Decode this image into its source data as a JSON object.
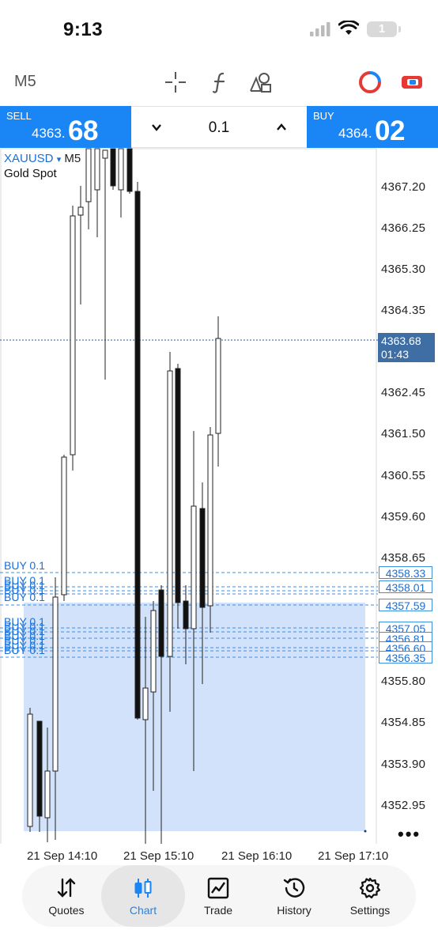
{
  "status_bar": {
    "time": "9:13",
    "battery": "1"
  },
  "toolbar": {
    "timeframe": "M5",
    "icons": [
      "crosshair-icon",
      "indicators-icon",
      "objects-icon",
      "flame-icon",
      "trade-toggle-icon"
    ]
  },
  "trade_panel": {
    "sell": {
      "label": "SELL",
      "price_prefix": "4363.",
      "price_big": "68"
    },
    "buy": {
      "label": "BUY",
      "price_prefix": "4364.",
      "price_big": "02"
    },
    "lot": "0.1"
  },
  "chart": {
    "symbol": "XAUUSD",
    "symbol_arrow": "▾",
    "timeframe": "M5",
    "description": "Gold Spot",
    "price_ticks": [
      "4367.20",
      "4366.25",
      "4365.30",
      "4364.35",
      "4362.45",
      "4361.50",
      "4360.55",
      "4359.60",
      "4358.65",
      "4355.80",
      "4354.85",
      "4353.90",
      "4352.95"
    ],
    "current_price": "4363.68",
    "countdown": "01:43",
    "order_prices": [
      "4358.33",
      "4358.01",
      "4357.59",
      "4357.05",
      "4356.81",
      "4356.60",
      "4356.35"
    ],
    "buy_label": "BUY 0.1",
    "time_labels": [
      "21 Sep 14:10",
      "21 Sep 15:10",
      "21 Sep 16:10",
      "21 Sep 17:10"
    ],
    "more": "•••",
    "colors": {
      "accent": "#1a86f5",
      "order_line": "#3d8fe0",
      "current_line": "#2f5a9e",
      "zone": "#d3e2fb"
    }
  },
  "tabs": [
    {
      "label": "Quotes",
      "icon": "quotes-icon"
    },
    {
      "label": "Chart",
      "icon": "chart-icon",
      "active": true
    },
    {
      "label": "Trade",
      "icon": "trade-icon"
    },
    {
      "label": "History",
      "icon": "history-icon"
    },
    {
      "label": "Settings",
      "icon": "settings-icon"
    }
  ]
}
